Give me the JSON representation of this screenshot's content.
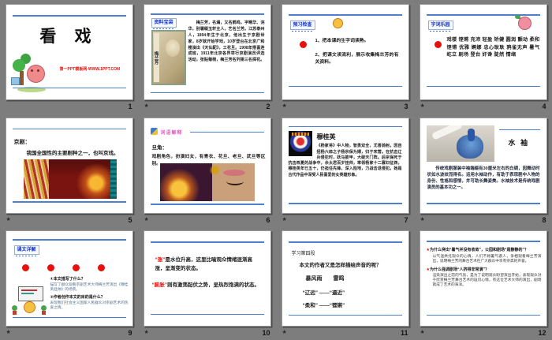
{
  "app": {
    "view": "powerpoint-slide-sorter",
    "background": "#7d7d7d"
  },
  "colors": {
    "accent_blue_line": "#4e7fd0",
    "label_blue": "#1533cc",
    "red": "#e8100c",
    "pink_label": "#e05cc0"
  },
  "slides": [
    {
      "num": "1",
      "transition": false,
      "title": "看 戏",
      "credit": "第一PPT模板网-WWW.1PPT.COM"
    },
    {
      "num": "2",
      "transition": true,
      "tag": "资料宝袋",
      "photo_caption": "梅兰芳",
      "body": "梅兰芳，名澜，又名鹤鸣，字畹华、浣华，别署缀玉轩主人，艺名兰芳。江苏泰州人，1894年生于北京，他出生于京剧世家，8岁就开始学戏，10岁登台在北京广和楼演出《天仙配》，工花旦。1908年搭喜连成班，1911年北京各界举行京剧演员评选活动，张贴菊榜，梅兰芳名列第三名探花。"
    },
    {
      "num": "3",
      "transition": true,
      "tag": "预习检查",
      "items": [
        "1、把本课的生字词读熟。",
        "2、把课文读流利，展示收集梅兰芳的有关资料。"
      ]
    },
    {
      "num": "4",
      "transition": true,
      "tag": "字词乐园",
      "words": "戏楼 铿锵 充沛 轻盈 矫健 圆润 颤动 柔和 铿锵 优雅 婀娜 忠心耿耿 鸦雀无声 暑气 屹立 剧场 登台 奸谗 陡然 情绪"
    },
    {
      "num": "5",
      "transition": true,
      "heading": "京剧：",
      "body": "我国全国性的主要剧种之一，也叫京戏。"
    },
    {
      "num": "6",
      "transition": true,
      "tag": "词语解释",
      "heading": "旦角：",
      "body": "戏剧角色，扮演妇女，有青衣、花旦、老旦、武旦等区别。"
    },
    {
      "num": "7",
      "transition": true,
      "heading": "穆桂英",
      "body": "《杨家将》中人物，智勇双全，尤善骑射。因自招杨六郎之子杨宗保为婿，归于宋营。在抗击辽兵侵犯时，跃马披甲，大破天门阵。后宗保死于抗击西夏的战争中，佘太君百岁挂帅，率领杨家十二寡妇征西，穆桂英年已五十，仍担任先锋，深入险地，力战击退侵犯。她是古代作品中深受人民喜爱的女英雄形象。"
    },
    {
      "num": "8",
      "transition": true,
      "heading": "水 袖",
      "body": "传统戏剧服装中袖端缀有30厘米左右的白绸，因舞动时状如水波纹而得名。运用水袖动作，有助于表现剧中人物的身份、性格和感情，并可助长舞姿美。水袖技术是传统戏剧演员的基本功之一。"
    },
    {
      "num": "9",
      "transition": true,
      "tag": "课文详解",
      "qa": [
        {
          "q": "①本文描写了什么？",
          "a": "描写了群众观看京剧艺术大师梅兰芳演出《穆桂英挂帅》的场景。"
        },
        {
          "q": "②作者创作本文的目的是什么？",
          "a": "表现我们社会主义国家人民群众对京剧艺术的热爱之情。"
        }
      ]
    },
    {
      "num": "10",
      "transition": true,
      "p1_hl": "“涨”",
      "p1": "是水位升高，这里比喻观众情绪逐渐高涨，呈渐变的状态。",
      "p2_hl": "“膨胀”",
      "p2": "则有激荡起伏之势，呈热烈饱满的状态。"
    },
    {
      "num": "11",
      "transition": true,
      "lines": [
        "学习第四段",
        "本文的作者又是怎样描绘声音的呢？",
        "暴风雨　　雷鸣",
        "“辽远” ——“逼近”",
        "“柔和” ——“铿锵”"
      ]
    },
    {
      "num": "12",
      "transition": true,
      "star": "★",
      "qa": [
        {
          "q": "为什么突出“暑气并没有收敛”，公园和剧场“是静静的”？",
          "a": "以气温烘托观众的心情，人们不顾暑气袭人，争相观看梅兰芳演出，说明梅兰芳的舞台艺术在广大群众中享有崇高的声誉。"
        },
        {
          "q": "为什么强调剧场“人挤得非常满”？",
          "a": "渲染演出之前的气氛，是为了说明观众盼望演出开始，表现观众对于欣赏梅兰芳舞台艺术的迫切心情，有这位艺术大师的演出，剧场就成了艺术的海洋。"
        }
      ]
    }
  ]
}
